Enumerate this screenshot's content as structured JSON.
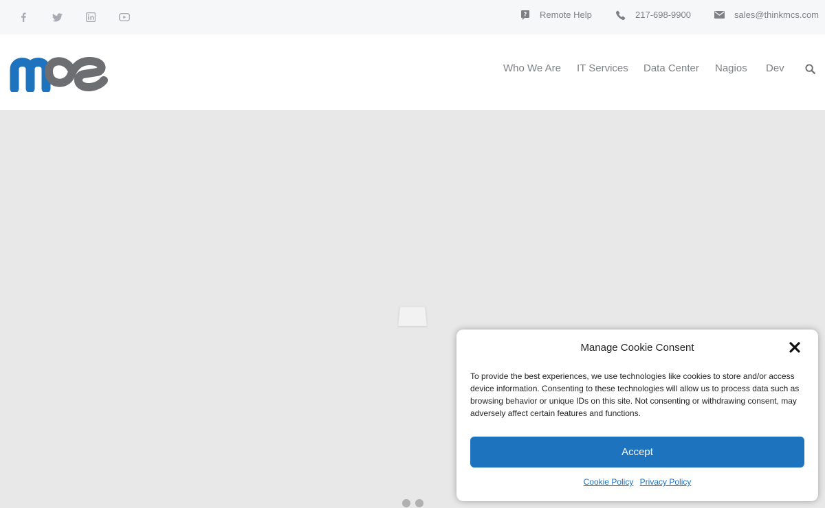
{
  "topbar": {
    "social": [
      {
        "icon": "facebook-icon"
      },
      {
        "icon": "twitter-icon"
      },
      {
        "icon": "linkedin-icon"
      },
      {
        "icon": "youtube-icon"
      }
    ],
    "remote_help": "Remote Help",
    "phone": "217-698-9900",
    "email": "sales@thinkmcs.com"
  },
  "nav": {
    "items": [
      "Who We Are",
      "IT Services",
      "Data Center",
      "Nagios",
      "Dev"
    ],
    "search_icon": "search-icon"
  },
  "colors": {
    "brand_blue": "#1e73be",
    "brand_grey": "#6d6e71",
    "topbar_bg": "#f6f7f9",
    "hero_bg": "#e8e8e8"
  },
  "cookie": {
    "title": "Manage Cookie Consent",
    "text": "To provide the best experiences, we use technologies like cookies to store and/or access device information. Consenting to these technologies will allow us to process data such as browsing behavior or unique IDs on this site. Not consenting or withdrawing consent, may adversely affect certain features and functions.",
    "accept_label": "Accept",
    "cookie_policy": "Cookie Policy",
    "privacy_policy": "Privacy Policy"
  }
}
